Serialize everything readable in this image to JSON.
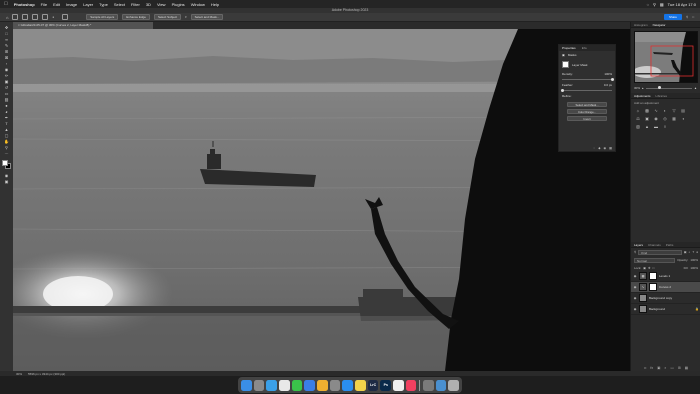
{
  "menubar": {
    "apple_icon": "apple-icon",
    "app": "Photoshop",
    "items": [
      "File",
      "Edit",
      "Image",
      "Layer",
      "Type",
      "Select",
      "Filter",
      "3D",
      "View",
      "Plugins",
      "Window",
      "Help"
    ],
    "clock": "Tue 18 Apr 17:0"
  },
  "window": {
    "title": "Adobe Photoshop 2023"
  },
  "options": {
    "sample_all_layers": "Sample All Layers",
    "enhance_edge": "Enhance Edge",
    "select_subject": "Select Subject",
    "select_and_mask": "Select and Mask...",
    "share": "Share"
  },
  "document": {
    "tab_title": "Gibraltar23-05-07 @ 30% (Curves 2, Layer Mask/8) *"
  },
  "properties": {
    "tabs": [
      "Properties",
      "Info"
    ],
    "mask_label": "Masks",
    "layer_mask": "Layer Mask",
    "density_label": "Density:",
    "density_value": "100%",
    "feather_label": "Feather:",
    "feather_value": "0.0 px",
    "density_level": 1.0,
    "feather_level": 0.0,
    "refine_label": "Refine:",
    "buttons": [
      "Select and Mask...",
      "Color Range...",
      "Invert"
    ]
  },
  "navigator": {
    "tabs": [
      "Histogram",
      "Navigator"
    ],
    "zoom": "30%",
    "zoom_level": 0.3
  },
  "adjustments": {
    "tabs": [
      "Adjustments",
      "Libraries"
    ],
    "subtitle": "Add an adjustment"
  },
  "layers": {
    "tabs": [
      "Layers",
      "Channels",
      "Paths"
    ],
    "kind": "Kind",
    "blend": "Normal",
    "opacity_label": "Opacity:",
    "opacity": "100%",
    "lock_label": "Lock:",
    "fill_label": "Fill:",
    "fill": "100%",
    "rows": [
      {
        "name": "Levels 1",
        "type": "adjustment",
        "selected": false
      },
      {
        "name": "Curves 2",
        "type": "adjustment",
        "selected": true
      },
      {
        "name": "Background copy",
        "type": "pixel",
        "selected": false
      },
      {
        "name": "Background",
        "type": "pixel",
        "selected": false
      }
    ]
  },
  "status": {
    "zoom": "30%",
    "doc_info": "5596 px x 3344 px (300 ppi)"
  },
  "dock": [
    {
      "name": "finder",
      "color": "#3a8ee6"
    },
    {
      "name": "launchpad",
      "color": "#8a8a8a"
    },
    {
      "name": "safari",
      "color": "#3aa0e8"
    },
    {
      "name": "chrome",
      "color": "#e8e8e8"
    },
    {
      "name": "messages",
      "color": "#3ac24a"
    },
    {
      "name": "mail",
      "color": "#3a7ee6"
    },
    {
      "name": "photos",
      "color": "#f0b030"
    },
    {
      "name": "settings",
      "color": "#8a8a8a"
    },
    {
      "name": "app-store",
      "color": "#2a8ef0"
    },
    {
      "name": "notes",
      "color": "#f2d24a"
    },
    {
      "name": "lightroom-classic",
      "color": "#1e2a44",
      "label": "LrC"
    },
    {
      "name": "photoshop",
      "color": "#0a2a4a",
      "label": "Ps"
    },
    {
      "name": "chrome-2",
      "color": "#f0f0f0"
    },
    {
      "name": "music",
      "color": "#f04060"
    },
    {
      "name": "preview",
      "color": "#7a7a7a"
    },
    {
      "name": "downloads",
      "color": "#4a90d0"
    },
    {
      "name": "trash",
      "color": "#b0b0b0"
    }
  ],
  "colors": {
    "accent": "#1473e6",
    "panel": "#2b2b2b",
    "toolbar": "#323232"
  }
}
